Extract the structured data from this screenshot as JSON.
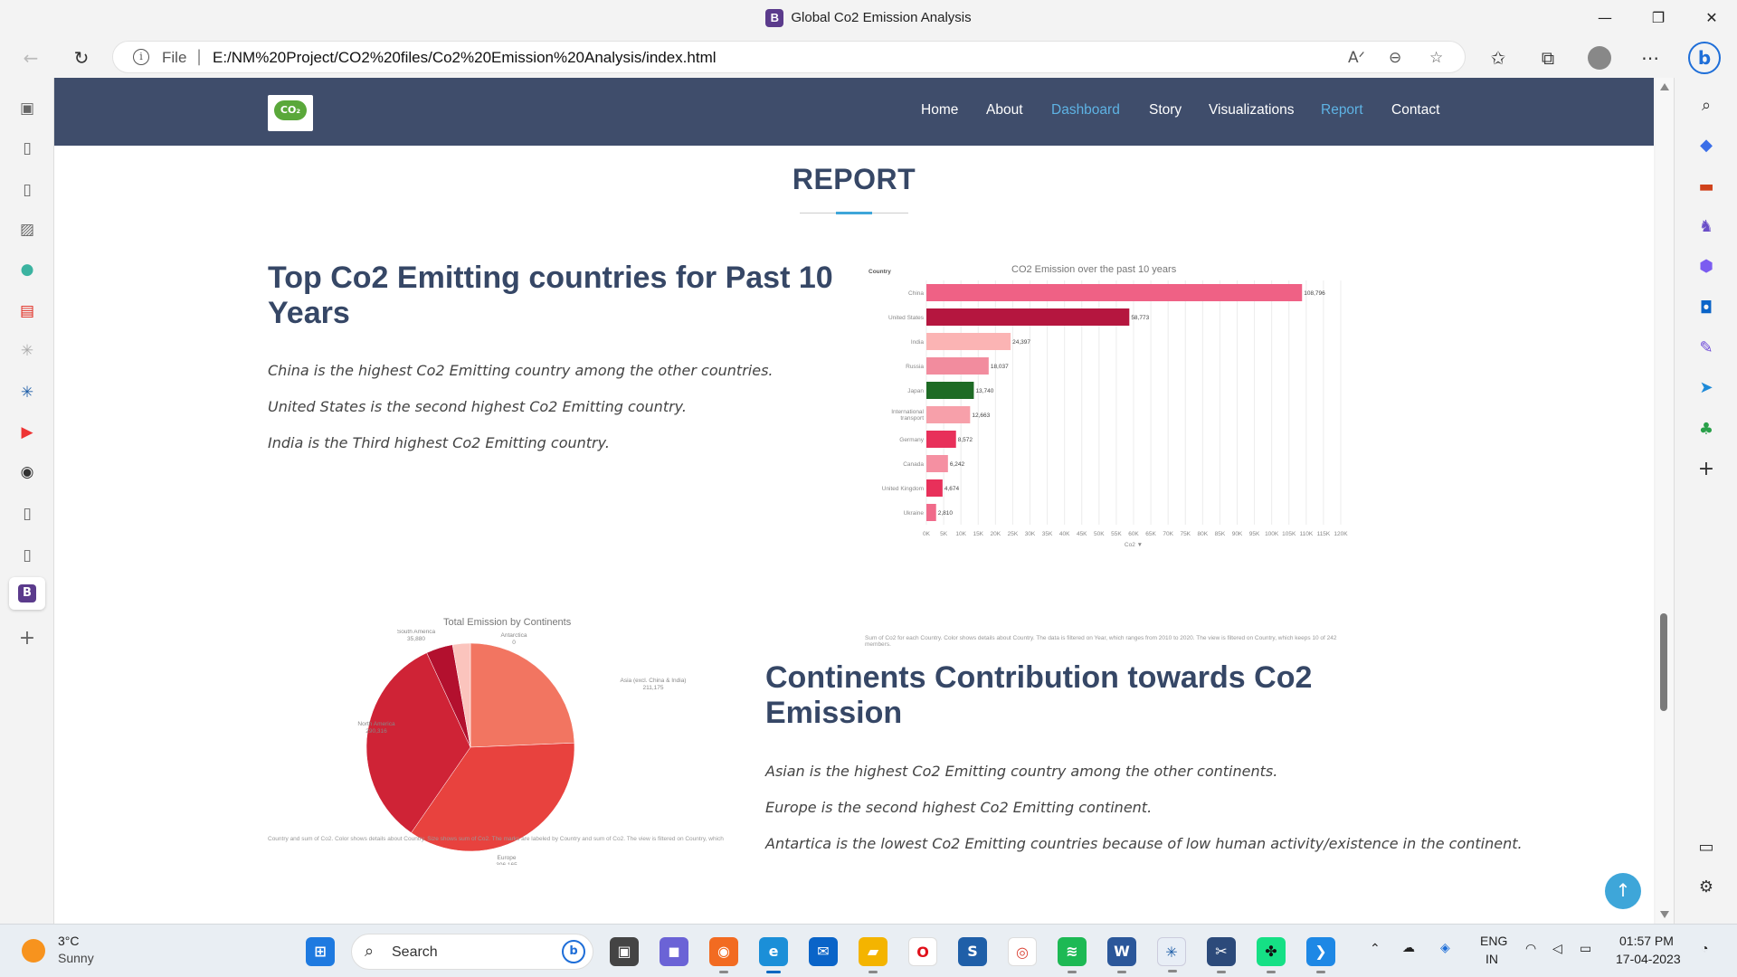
{
  "window": {
    "title": "Global Co2 Emission Analysis",
    "favicon_letter": "B",
    "minimize": "—",
    "restore": "❐",
    "close": "✕"
  },
  "browser": {
    "scheme_label": "File",
    "url": "E:/NM%20Project/CO2%20files/Co2%20Emission%20Analysis/index.html",
    "info_icon": "i",
    "read_aloud": "Aᐟ"
  },
  "site": {
    "logo_text": "CO₂",
    "nav": [
      {
        "label": "Home",
        "active": false
      },
      {
        "label": "About",
        "active": false
      },
      {
        "label": "Dashboard",
        "active": true
      },
      {
        "label": "Story",
        "active": false
      },
      {
        "label": "Visualizations",
        "active": false
      },
      {
        "label": "Report",
        "active": true
      },
      {
        "label": "Contact",
        "active": false
      }
    ],
    "heading": "REPORT",
    "section1": {
      "title": "Top Co2 Emitting countries for Past 10 Years",
      "lines": [
        "China is the highest Co2 Emitting country among the other countries.",
        "United States is the second highest Co2 Emitting country.",
        "India is the Third highest Co2 Emitting country."
      ]
    },
    "section2": {
      "title": "Continents Contribution towards Co2 Emission",
      "lines": [
        "Asian is the highest Co2 Emitting country among the other continents.",
        "Europe is the second highest Co2 Emitting continent.",
        "Antartica is the lowest Co2 Emitting countries because of low human activity/existence in the continent."
      ]
    }
  },
  "chart_data": [
    {
      "type": "bar",
      "orientation": "horizontal",
      "title": "CO2 Emission over the past 10 years",
      "ylabel": "Country",
      "xlabel": "Co2 ▼",
      "categories": [
        "China",
        "United States",
        "India",
        "Russia",
        "Japan",
        "International transport",
        "Germany",
        "Canada",
        "United Kingdom",
        "Ukraine"
      ],
      "values": [
        108796,
        58773,
        24397,
        18037,
        13740,
        12663,
        8572,
        6242,
        4674,
        2810
      ],
      "value_labels": [
        "108,796",
        "58,773",
        "24,397",
        "18,037",
        "13,740",
        "12,663",
        "8,572",
        "6,242",
        "4,674",
        "2,810"
      ],
      "colors": [
        "#ef6185",
        "#b5163f",
        "#fbb4b4",
        "#f28c9e",
        "#1e6b25",
        "#f7a0aa",
        "#e8305a",
        "#f590a2",
        "#e8305a",
        "#f06a8a"
      ],
      "xticks": [
        "0K",
        "5K",
        "10K",
        "15K",
        "20K",
        "25K",
        "30K",
        "35K",
        "40K",
        "45K",
        "50K",
        "55K",
        "60K",
        "65K",
        "70K",
        "75K",
        "80K",
        "85K",
        "90K",
        "95K",
        "100K",
        "105K",
        "110K",
        "115K",
        "120K"
      ],
      "xlim": [
        0,
        120000
      ],
      "grid": true,
      "caption": "Sum of Co2 for each Country. Color shows details about Country. The data is filtered on Year, which ranges from 2010 to 2020. The view is filtered on Country, which keeps 10 of 242 members."
    },
    {
      "type": "pie",
      "title": "Total Emission by Continents",
      "categories": [
        "Antarctica",
        "Asia (excl. China & India)",
        "Europe",
        "North America",
        "South America",
        "Oceania"
      ],
      "values": [
        0,
        211175,
        306165,
        290316,
        35880,
        24000
      ],
      "value_labels": [
        "0",
        "211,175",
        "306,165",
        "290,316",
        "35,880",
        ""
      ],
      "label_names": [
        "Antarctica",
        "Asia (excl. China & India)",
        "Europe",
        "North America",
        "South America",
        ""
      ],
      "colors": [
        "#f7b3ad",
        "#f27561",
        "#e8423e",
        "#cf2336",
        "#b3102e",
        "#fbc4bd"
      ],
      "caption": "Country and sum of Co2. Color shows details about Country. Size shows sum of Co2. The marks are labeled by Country and sum of Co2. The view is filtered on Country, which"
    }
  ],
  "taskbar": {
    "temperature": "3°C",
    "condition": "Sunny",
    "search_label": "Search",
    "lang1": "ENG",
    "lang2": "IN",
    "time": "01:57 PM",
    "date": "17-04-2023"
  }
}
